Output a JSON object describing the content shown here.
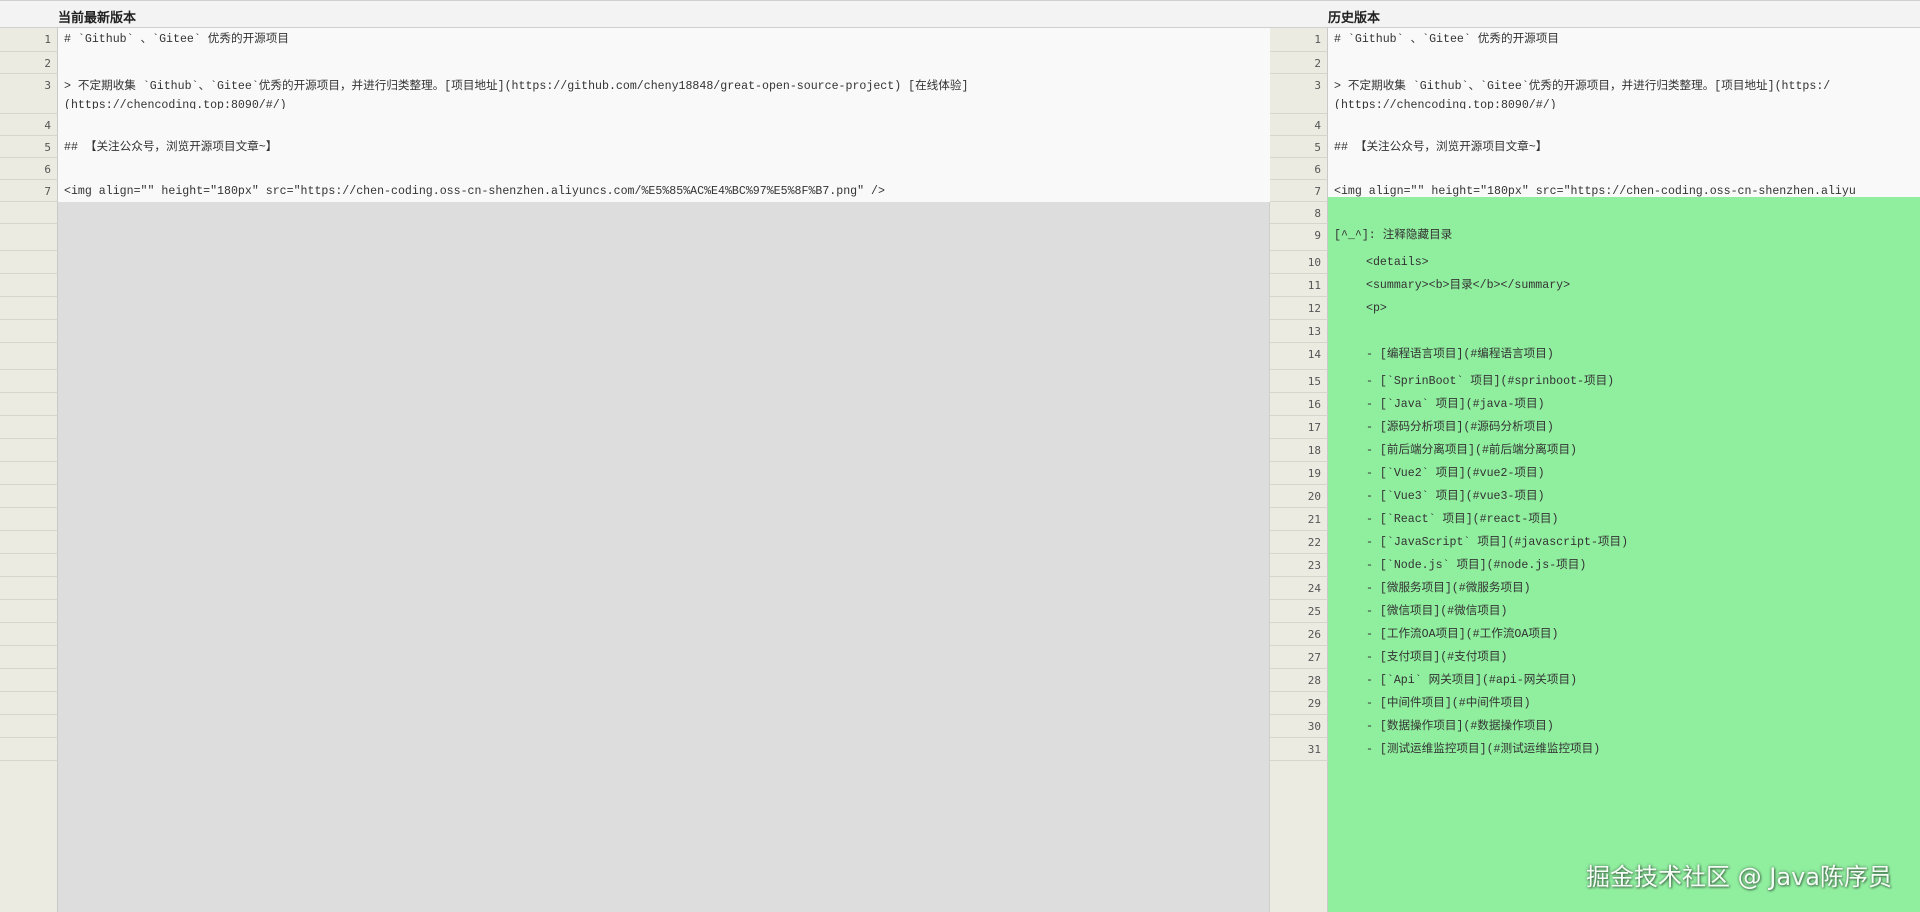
{
  "headers": {
    "left": "当前最新版本",
    "right": "历史版本"
  },
  "left_lines": [
    {
      "n": "1",
      "text": "# `Github` 、`Gitee` 优秀的开源项目"
    },
    {
      "n": "2",
      "text": ""
    },
    {
      "n": "3",
      "text": "> 不定期收集 `Github`、`Gitee`优秀的开源项目，并进行归类整理。[项目地址](https://github.com/cheny18848/great-open-source-project) [在线体验]\n(https://chencoding.top:8090/#/)"
    },
    {
      "n": "4",
      "text": ""
    },
    {
      "n": "5",
      "text": "## 【关注公众号，浏览开源项目文章~】"
    },
    {
      "n": "6",
      "text": ""
    },
    {
      "n": "7",
      "text": "<img align=\"\" height=\"180px\" src=\"https://chen-coding.oss-cn-shenzhen.aliyuncs.com/%E5%85%AC%E4%BC%97%E5%8F%B7.png\" />"
    }
  ],
  "right_lines": [
    {
      "n": "1",
      "text": "# `Github` 、`Gitee` 优秀的开源项目"
    },
    {
      "n": "2",
      "text": ""
    },
    {
      "n": "3",
      "text": "> 不定期收集 `Github`、`Gitee`优秀的开源项目，并进行归类整理。[项目地址](https:/\n(https://chencoding.top:8090/#/)"
    },
    {
      "n": "4",
      "text": ""
    },
    {
      "n": "5",
      "text": "## 【关注公众号，浏览开源项目文章~】"
    },
    {
      "n": "6",
      "text": ""
    },
    {
      "n": "7",
      "text": "<img align=\"\" height=\"180px\" src=\"https://chen-coding.oss-cn-shenzhen.aliyu"
    },
    {
      "n": "8",
      "text": ""
    },
    {
      "n": "9",
      "text": "[^_^]: 注释隐藏目录"
    },
    {
      "n": "10",
      "text": "<details>"
    },
    {
      "n": "11",
      "text": "<summary><b>目录</b></summary>"
    },
    {
      "n": "12",
      "text": "<p>"
    },
    {
      "n": "13",
      "text": ""
    },
    {
      "n": "14",
      "text": "- [编程语言项目](#编程语言项目)"
    },
    {
      "n": "15",
      "text": "- [`SprinBoot` 项目](#sprinboot-项目)"
    },
    {
      "n": "16",
      "text": "- [`Java` 项目](#java-项目)"
    },
    {
      "n": "17",
      "text": "- [源码分析项目](#源码分析项目)"
    },
    {
      "n": "18",
      "text": "- [前后端分离项目](#前后端分离项目)"
    },
    {
      "n": "19",
      "text": "- [`Vue2` 项目](#vue2-项目)"
    },
    {
      "n": "20",
      "text": "- [`Vue3` 项目](#vue3-项目)"
    },
    {
      "n": "21",
      "text": "- [`React` 项目](#react-项目)"
    },
    {
      "n": "22",
      "text": "- [`JavaScript` 项目](#javascript-项目)"
    },
    {
      "n": "23",
      "text": "- [`Node.js` 项目](#node.js-项目)"
    },
    {
      "n": "24",
      "text": "- [微服务项目](#微服务项目)"
    },
    {
      "n": "25",
      "text": "- [微信项目](#微信项目)"
    },
    {
      "n": "26",
      "text": "- [工作流OA项目](#工作流OA项目)"
    },
    {
      "n": "27",
      "text": "- [支付项目](#支付项目)"
    },
    {
      "n": "28",
      "text": "- [`Api` 网关项目](#api-网关项目)"
    },
    {
      "n": "29",
      "text": "- [中间件项目](#中间件项目)"
    },
    {
      "n": "30",
      "text": "- [数据操作项目](#数据操作项目)"
    },
    {
      "n": "31",
      "text": "- [测试运维监控项目](#测试运维监控项目)"
    }
  ],
  "watermark": "掘金技术社区 @ Java陈序员",
  "colors": {
    "added": "#90ee9f",
    "empty": "#dddddd",
    "gutter": "#ebebe1"
  }
}
